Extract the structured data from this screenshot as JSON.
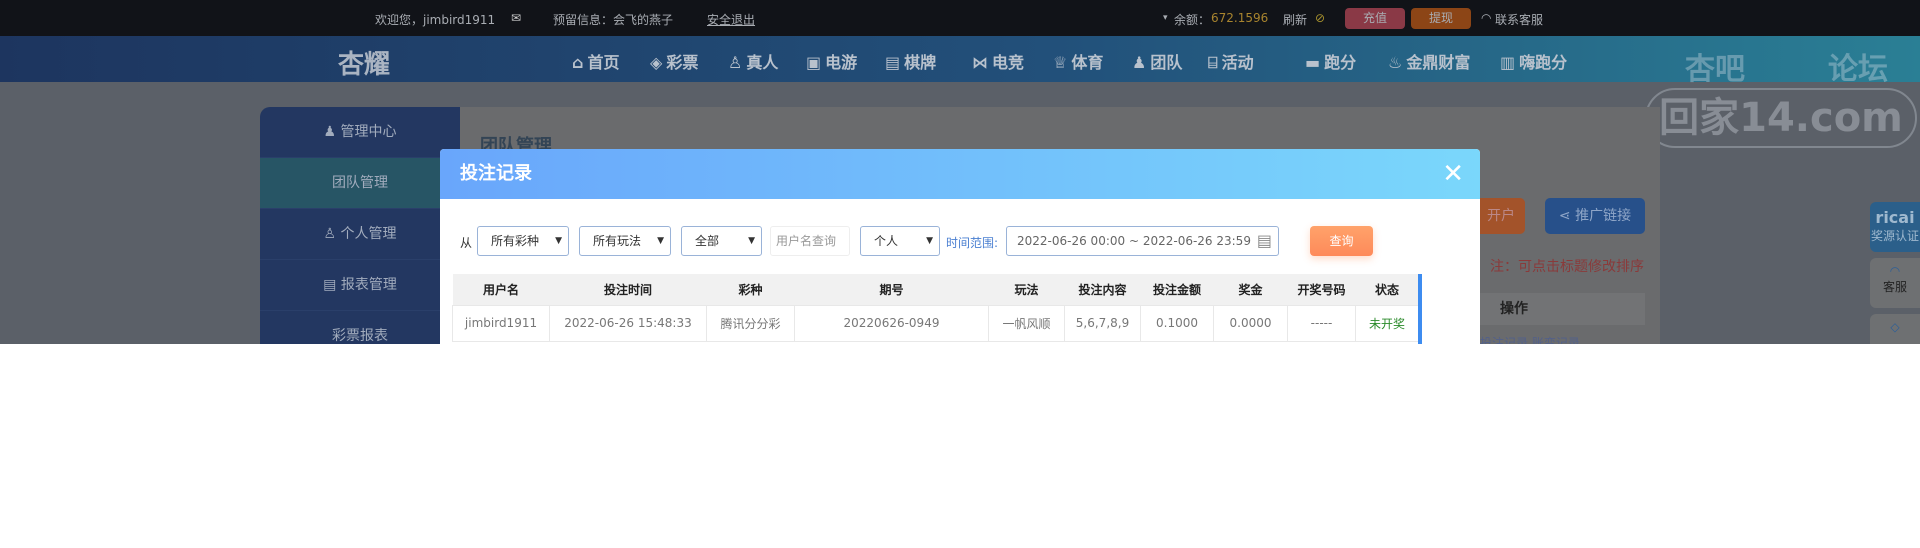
{
  "topbar": {
    "welcome": "欢迎您，jimbird1911",
    "reserved_info": "预留信息：会飞的燕子",
    "logout": "安全退出",
    "balance_label": "余额：",
    "balance": "672.1596",
    "refresh": "刷新",
    "deposit": "充值",
    "withdraw": "提现",
    "support": "联系客服"
  },
  "nav": {
    "logo": "杏耀",
    "items": [
      "首页",
      "彩票",
      "真人",
      "电游",
      "棋牌",
      "电竞",
      "体育",
      "团队",
      "活动",
      "跑分",
      "金鼎财富",
      "嗨跑分"
    ]
  },
  "watermark": {
    "line1a": "杏吧",
    "line1b": "论坛",
    "line2": "回家14.com"
  },
  "sidebar": {
    "items": [
      "管理中心",
      "团队管理",
      "个人管理",
      "报表管理",
      "彩票报表"
    ]
  },
  "main": {
    "title": "团队管理",
    "open_account": "开户",
    "promo_link": "推广链接",
    "note": "注：可点击标题修改排序",
    "op_header": "操作",
    "op_links": "投注记录  账变记录"
  },
  "float": {
    "brand": "ricai",
    "cert": "奖源认证",
    "service": "客服"
  },
  "modal": {
    "title": "投注记录",
    "close": "✕",
    "filters": {
      "from": "从",
      "lottery": "所有彩种",
      "play": "所有玩法",
      "scope": "全部",
      "username_placeholder": "用户名查询",
      "mode": "个人",
      "time_label": "时间范围:",
      "date_range": "2022-06-26 00:00 ~ 2022-06-26 23:59",
      "query": "查询"
    },
    "table": {
      "headers": [
        "用户名",
        "投注时间",
        "彩种",
        "期号",
        "玩法",
        "投注内容",
        "投注金额",
        "奖金",
        "开奖号码",
        "状态"
      ],
      "rows": [
        [
          "jimbird1911",
          "2022-06-26 15:48:33",
          "腾讯分分彩",
          "20220626-0949",
          "一帆风顺",
          "5,6,7,8,9",
          "0.1000",
          "0.0000",
          "-----",
          "未开奖"
        ]
      ]
    }
  },
  "colors": {
    "modal_header_start": "#69a6fb",
    "modal_header_end": "#7ad7fb",
    "query_button": "#fe8a5a",
    "status_pending": "#2a8a2a"
  }
}
